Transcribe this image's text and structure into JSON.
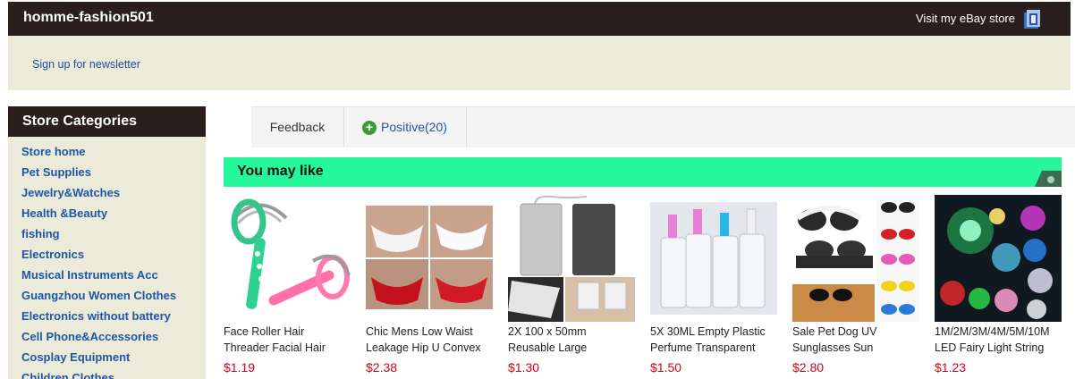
{
  "header": {
    "store_name": "homme-fashion501",
    "visit_label": "Visit my eBay store",
    "newsletter_label": "Sign up for newsletter"
  },
  "sidebar": {
    "title": "Store Categories",
    "items": [
      {
        "label": "Store home"
      },
      {
        "label": "Pet Supplies"
      },
      {
        "label": "Jewelry&Watches"
      },
      {
        "label": "Health &Beauty"
      },
      {
        "label": "fishing"
      },
      {
        "label": "Electronics"
      },
      {
        "label": "Musical Instruments Acc"
      },
      {
        "label": "Guangzhou Women Clothes"
      },
      {
        "label": "Electronics without battery"
      },
      {
        "label": "Cell Phone&Accessories"
      },
      {
        "label": "Cosplay Equipment"
      },
      {
        "label": "Children Clothes"
      }
    ]
  },
  "feedback": {
    "tab_label": "Feedback",
    "positive_label": "Positive(20)"
  },
  "recommendations": {
    "title": "You may like",
    "items": [
      {
        "title_line1": "Face Roller Hair",
        "title_line2": "Threader Facial Hair",
        "price": "$1.19"
      },
      {
        "title_line1": "Chic Mens Low Waist",
        "title_line2": "Leakage Hip U Convex",
        "price": "$2.38"
      },
      {
        "title_line1": "2X 100 x 50mm",
        "title_line2": "Reusable Large",
        "price": "$1.30"
      },
      {
        "title_line1": "5X 30ML Empty Plastic",
        "title_line2": "Perfume Transparent",
        "price": "$1.50"
      },
      {
        "title_line1": "Sale Pet Dog UV",
        "title_line2": "Sunglasses Sun",
        "price": "$2.80"
      },
      {
        "title_line1": "1M/2M/3M/4M/5M/10M",
        "title_line2": "LED Fairy Light String",
        "price": "$1.23"
      }
    ]
  },
  "colors": {
    "header_bg": "#2a1f1c",
    "band_bg": "#ecebd9",
    "link": "#1f55a8",
    "accent_green": "#26f79a",
    "price_red": "#d0021b"
  }
}
